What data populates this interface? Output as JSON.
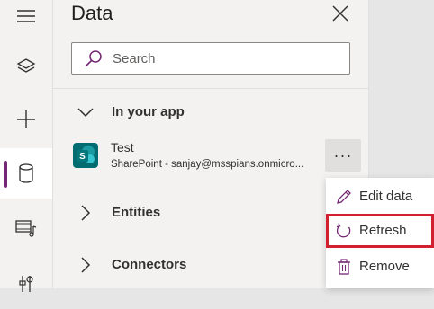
{
  "accent": "#742774",
  "rail": {
    "items": [
      {
        "icon": "hamburger-icon"
      },
      {
        "icon": "layers-icon"
      },
      {
        "icon": "plus-icon"
      },
      {
        "icon": "database-icon",
        "active": true
      },
      {
        "icon": "media-icon"
      },
      {
        "icon": "tools-icon"
      }
    ]
  },
  "panel": {
    "title": "Data",
    "search_placeholder": "Search",
    "in_your_app_label": "In your app",
    "source": {
      "name": "Test",
      "subtitle": "SharePoint - sanjay@msspians.onmicro...",
      "more_label": "···"
    },
    "entities_label": "Entities",
    "connectors_label": "Connectors"
  },
  "context_menu": {
    "items": [
      {
        "label": "Edit data",
        "icon": "pencil-icon"
      },
      {
        "label": "Refresh",
        "icon": "refresh-icon",
        "highlighted": true
      },
      {
        "label": "Remove",
        "icon": "trash-icon"
      }
    ]
  }
}
